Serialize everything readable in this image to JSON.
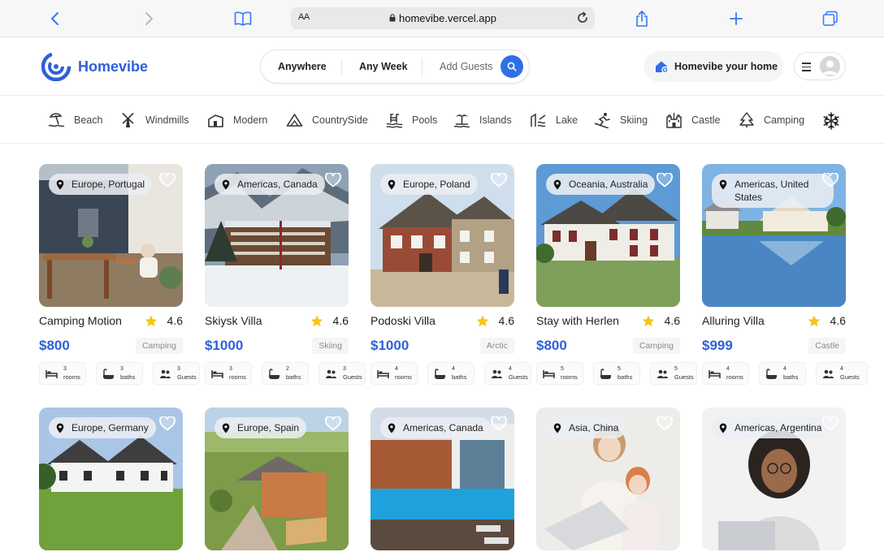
{
  "browser": {
    "aa_label": "AA",
    "url": "homevibe.vercel.app"
  },
  "header": {
    "brand": "Homevibe",
    "search": {
      "where": "Anywhere",
      "when": "Any Week",
      "who": "Add Guests"
    },
    "host_label": "Homevibe your home"
  },
  "categories": [
    {
      "label": "Beach",
      "icon": "beach-icon"
    },
    {
      "label": "Windmills",
      "icon": "windmill-icon"
    },
    {
      "label": "Modern",
      "icon": "modern-house-icon"
    },
    {
      "label": "CountrySide",
      "icon": "mountain-icon"
    },
    {
      "label": "Pools",
      "icon": "pool-icon"
    },
    {
      "label": "Islands",
      "icon": "island-icon"
    },
    {
      "label": "Lake",
      "icon": "lake-icon"
    },
    {
      "label": "Skiing",
      "icon": "skiing-icon"
    },
    {
      "label": "Castle",
      "icon": "castle-icon"
    },
    {
      "label": "Camping",
      "icon": "camping-icon"
    },
    {
      "label": "",
      "icon": "snowflake-icon"
    }
  ],
  "listings": [
    {
      "location": "Europe, Portugal",
      "title": "Camping Motion",
      "rating": "4.6",
      "price": "$800",
      "category": "Camping",
      "rooms": "3",
      "rooms_label": "rooms",
      "baths": "3",
      "baths_label": "baths",
      "guests": "3",
      "guests_label": "Guests"
    },
    {
      "location": "Americas, Canada",
      "title": "Skiysk Villa",
      "rating": "4.6",
      "price": "$1000",
      "category": "Skiing",
      "rooms": "3",
      "rooms_label": "rooms",
      "baths": "2",
      "baths_label": "baths",
      "guests": "3",
      "guests_label": "Guests"
    },
    {
      "location": "Europe, Poland",
      "title": "Podoski Villa",
      "rating": "4.6",
      "price": "$1000",
      "category": "Arctic",
      "rooms": "4",
      "rooms_label": "rooms",
      "baths": "4",
      "baths_label": "baths",
      "guests": "4",
      "guests_label": "Guests"
    },
    {
      "location": "Oceania, Australia",
      "title": "Stay with Herlen",
      "rating": "4.6",
      "price": "$800",
      "category": "Camping",
      "rooms": "5",
      "rooms_label": "rooms",
      "baths": "5",
      "baths_label": "baths",
      "guests": "5",
      "guests_label": "Guests"
    },
    {
      "location": "Americas, United States",
      "title": "Alluring Villa",
      "rating": "4.6",
      "price": "$999",
      "category": "Castle",
      "rooms": "4",
      "rooms_label": "rooms",
      "baths": "4",
      "baths_label": "baths",
      "guests": "4",
      "guests_label": "Guests"
    },
    {
      "location": "Europe, Germany"
    },
    {
      "location": "Europe, Spain"
    },
    {
      "location": "Americas, Canada"
    },
    {
      "location": "Asia, China"
    },
    {
      "location": "Americas, Argentina"
    }
  ],
  "colors": {
    "brand": "#2f5fd9",
    "search_button": "#2f6fe6",
    "star": "#f5c518"
  }
}
